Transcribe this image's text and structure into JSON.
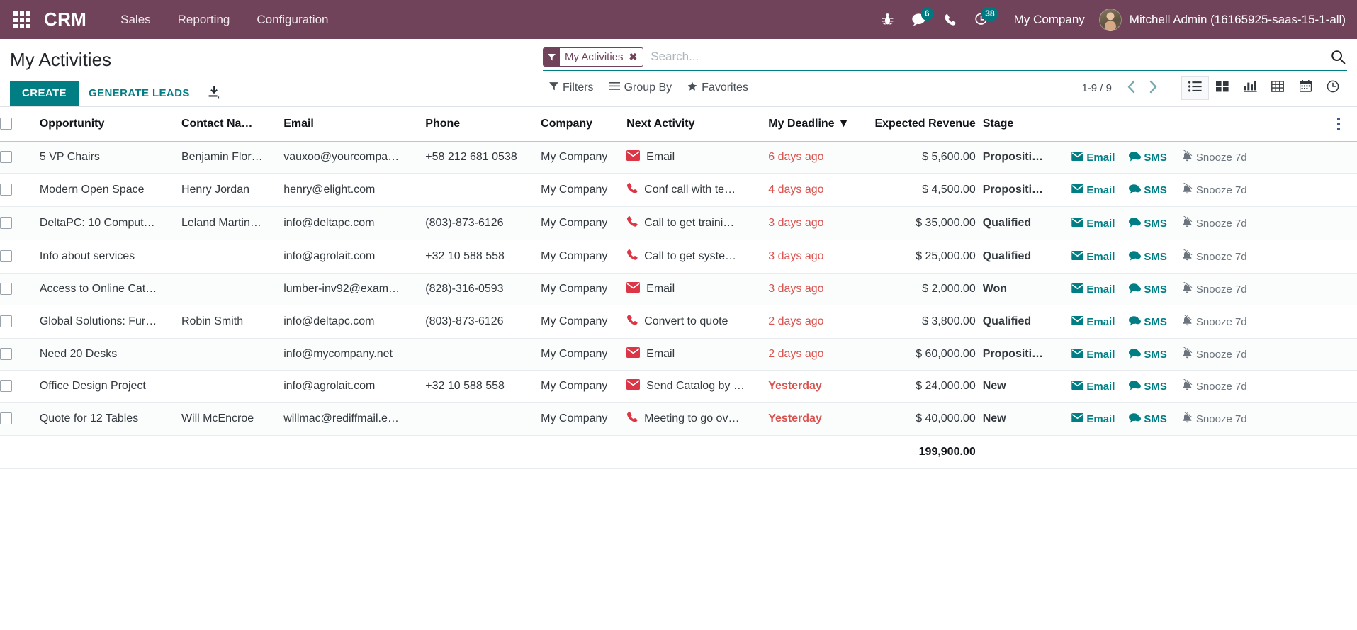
{
  "navbar": {
    "apps_icon": "apps-grid-icon",
    "brand": "CRM",
    "menus": [
      {
        "label": "Sales"
      },
      {
        "label": "Reporting"
      },
      {
        "label": "Configuration"
      }
    ],
    "systray": {
      "debug_icon": "bug-icon",
      "messages_icon": "messages-icon",
      "messages_count": "6",
      "phone_icon": "phone-icon",
      "activities_icon": "activity-clock-icon",
      "activities_count": "38",
      "company": "My Company",
      "avatar": "user-avatar",
      "username": "Mitchell Admin (16165925-saas-15-1-all)"
    }
  },
  "control_panel": {
    "title": "My Activities",
    "create_label": "CREATE",
    "generate_leads_label": "GENERATE LEADS",
    "import_icon": "import-download-icon",
    "search": {
      "facet_icon": "filter-funnel-icon",
      "facet_label": "My Activities",
      "facet_remove": "✖",
      "placeholder": "Search...",
      "value": "",
      "magnifier_icon": "search-icon"
    },
    "filters_label": "Filters",
    "group_by_label": "Group By",
    "favorites_label": "Favorites",
    "pager": "1-9 / 9",
    "prev_icon": "chevron-left-icon",
    "next_icon": "chevron-right-icon",
    "views": [
      {
        "name": "list",
        "icon": "list-view-icon",
        "active": true
      },
      {
        "name": "kanban",
        "icon": "kanban-view-icon",
        "active": false
      },
      {
        "name": "graph",
        "icon": "graph-view-icon",
        "active": false
      },
      {
        "name": "pivot",
        "icon": "pivot-view-icon",
        "active": false
      },
      {
        "name": "calendar",
        "icon": "calendar-view-icon",
        "active": false
      },
      {
        "name": "activity",
        "icon": "activity-view-icon",
        "active": false
      }
    ]
  },
  "table": {
    "columns": [
      "Opportunity",
      "Contact Na…",
      "Email",
      "Phone",
      "Company",
      "Next Activity",
      "My Deadline",
      "Expected Revenue",
      "Stage"
    ],
    "sorted_column": "My Deadline",
    "sort_caret": "▼",
    "optional_columns_icon": "vertical-ellipsis-icon",
    "row_actions": {
      "email_label": "Email",
      "email_icon": "envelope-icon",
      "sms_label": "SMS",
      "sms_icon": "comment-icon",
      "snooze_label": "Snooze 7d",
      "snooze_icon": "bell-slash-icon"
    },
    "rows": [
      {
        "opportunity": "5 VP Chairs",
        "contact": "Benjamin Flor…",
        "email": "vauxoo@yourcompa…",
        "phone": "+58 212 681 0538",
        "company": "My Company",
        "activity_icon": "envelope-icon",
        "activity": "Email",
        "deadline": "6 days ago",
        "deadline_bold": false,
        "revenue": "$ 5,600.00",
        "stage": "Propositi…"
      },
      {
        "opportunity": "Modern Open Space",
        "contact": "Henry Jordan",
        "email": "henry@elight.com",
        "phone": "",
        "company": "My Company",
        "activity_icon": "phone-icon",
        "activity": "Conf call with te…",
        "deadline": "4 days ago",
        "deadline_bold": false,
        "revenue": "$ 4,500.00",
        "stage": "Propositi…"
      },
      {
        "opportunity": "DeltaPC: 10 Comput…",
        "contact": "Leland Martin…",
        "email": "info@deltapc.com",
        "phone": "(803)-873-6126",
        "company": "My Company",
        "activity_icon": "phone-icon",
        "activity": "Call to get traini…",
        "deadline": "3 days ago",
        "deadline_bold": false,
        "revenue": "$ 35,000.00",
        "stage": "Qualified"
      },
      {
        "opportunity": "Info about services",
        "contact": "",
        "email": "info@agrolait.com",
        "phone": "+32 10 588 558",
        "company": "My Company",
        "activity_icon": "phone-icon",
        "activity": "Call to get syste…",
        "deadline": "3 days ago",
        "deadline_bold": false,
        "revenue": "$ 25,000.00",
        "stage": "Qualified"
      },
      {
        "opportunity": "Access to Online Cat…",
        "contact": "",
        "email": "lumber-inv92@exam…",
        "phone": "(828)-316-0593",
        "company": "My Company",
        "activity_icon": "envelope-icon",
        "activity": "Email",
        "deadline": "3 days ago",
        "deadline_bold": false,
        "revenue": "$ 2,000.00",
        "stage": "Won"
      },
      {
        "opportunity": "Global Solutions: Fur…",
        "contact": "Robin Smith",
        "email": "info@deltapc.com",
        "phone": "(803)-873-6126",
        "company": "My Company",
        "activity_icon": "phone-icon",
        "activity": "Convert to quote",
        "deadline": "2 days ago",
        "deadline_bold": false,
        "revenue": "$ 3,800.00",
        "stage": "Qualified"
      },
      {
        "opportunity": "Need 20 Desks",
        "contact": "",
        "email": "info@mycompany.net",
        "phone": "",
        "company": "My Company",
        "activity_icon": "envelope-icon",
        "activity": "Email",
        "deadline": "2 days ago",
        "deadline_bold": false,
        "revenue": "$ 60,000.00",
        "stage": "Propositi…"
      },
      {
        "opportunity": "Office Design Project",
        "contact": "",
        "email": "info@agrolait.com",
        "phone": "+32 10 588 558",
        "company": "My Company",
        "activity_icon": "envelope-icon",
        "activity": "Send Catalog by …",
        "deadline": "Yesterday",
        "deadline_bold": true,
        "revenue": "$ 24,000.00",
        "stage": "New"
      },
      {
        "opportunity": "Quote for 12 Tables",
        "contact": "Will McEncroe",
        "email": "willmac@rediffmail.e…",
        "phone": "",
        "company": "My Company",
        "activity_icon": "phone-icon",
        "activity": "Meeting to go ov…",
        "deadline": "Yesterday",
        "deadline_bold": true,
        "revenue": "$ 40,000.00",
        "stage": "New"
      }
    ],
    "total_revenue": "199,900.00"
  },
  "colors": {
    "brand_purple": "#71435b",
    "accent_teal": "#017e84",
    "alert_red": "#d9534f",
    "muted_gray": "#6c757d"
  }
}
